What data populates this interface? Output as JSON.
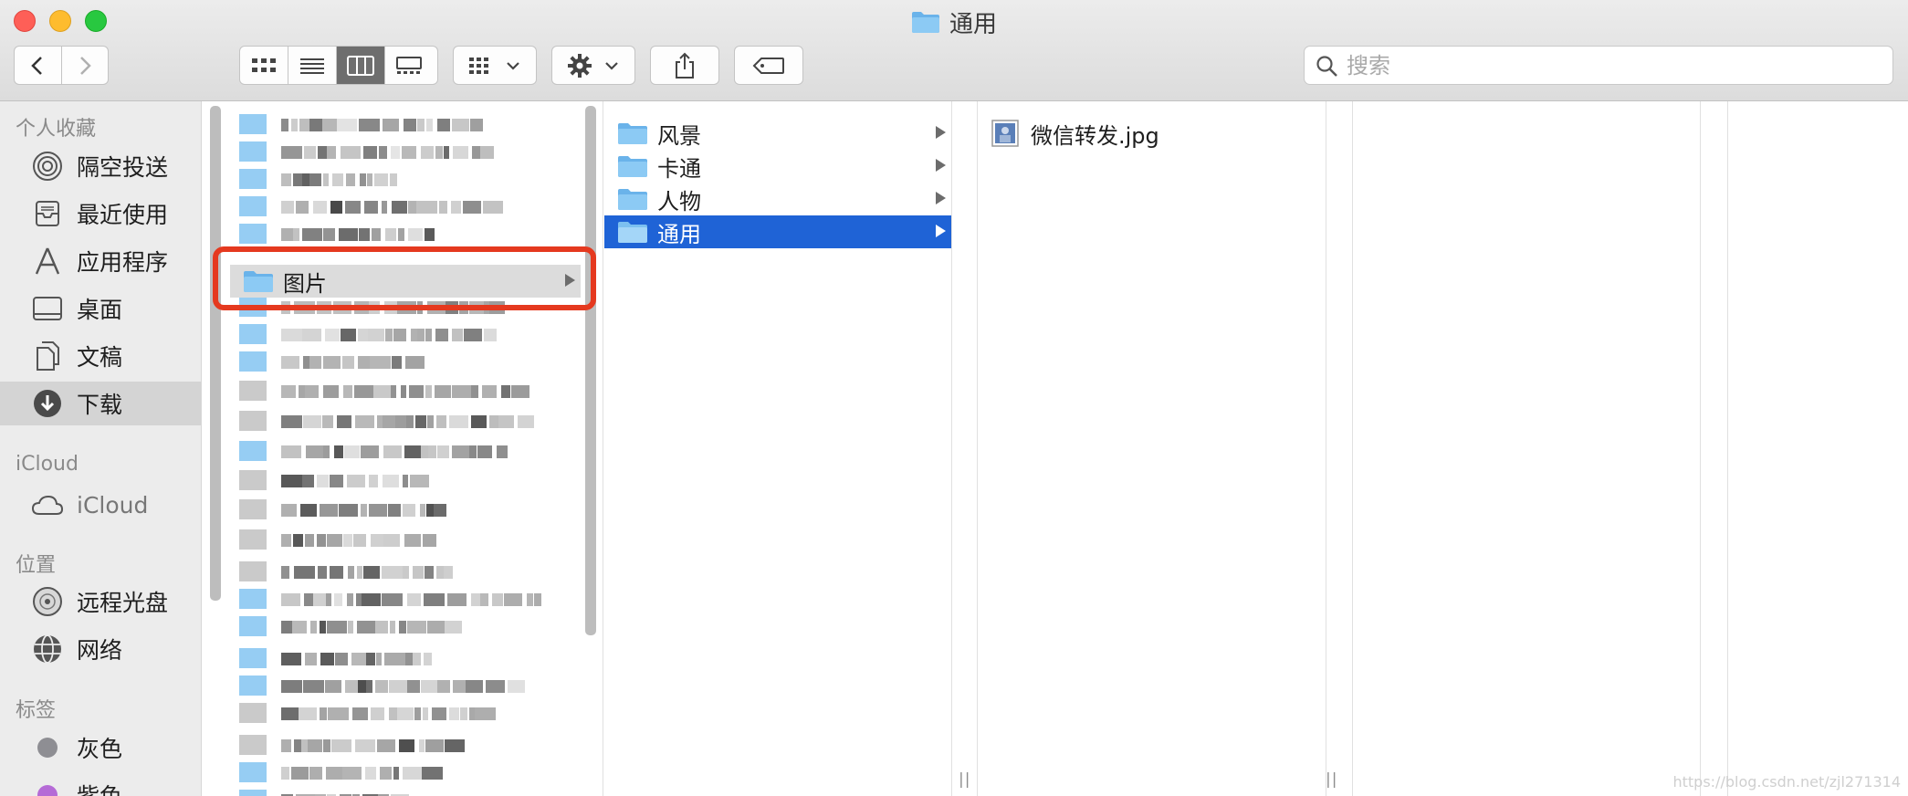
{
  "window": {
    "title": "通用"
  },
  "toolbar": {
    "search_placeholder": "搜索"
  },
  "sidebar": {
    "favorites_header": "个人收藏",
    "favorites": [
      {
        "label": "隔空投送",
        "icon": "airdrop-icon"
      },
      {
        "label": "最近使用",
        "icon": "recents-icon"
      },
      {
        "label": "应用程序",
        "icon": "applications-icon"
      },
      {
        "label": "桌面",
        "icon": "desktop-icon"
      },
      {
        "label": "文稿",
        "icon": "documents-icon"
      },
      {
        "label": "下载",
        "icon": "downloads-icon"
      }
    ],
    "icloud_header": "iCloud",
    "icloud_label": "iCloud",
    "locations_header": "位置",
    "locations": [
      {
        "label": "远程光盘",
        "icon": "remote-disc-icon"
      },
      {
        "label": "网络",
        "icon": "network-icon"
      }
    ],
    "tags_header": "标签",
    "tags": [
      {
        "label": "灰色",
        "color": "#8e8e93"
      },
      {
        "label": "紫色",
        "color": "#b56bd6"
      }
    ]
  },
  "column1": {
    "highlighted_label": "图片"
  },
  "column2": {
    "items": [
      {
        "label": "风景"
      },
      {
        "label": "卡通"
      },
      {
        "label": "人物"
      },
      {
        "label": "通用"
      }
    ]
  },
  "column3": {
    "items": [
      {
        "label": "微信转发.jpg"
      }
    ]
  },
  "colors": {
    "selection": "#1f63d6",
    "annotation_box": "#e5391f",
    "folder": "#6ab3ea"
  },
  "watermark": "https://blog.csdn.net/zjl271314"
}
